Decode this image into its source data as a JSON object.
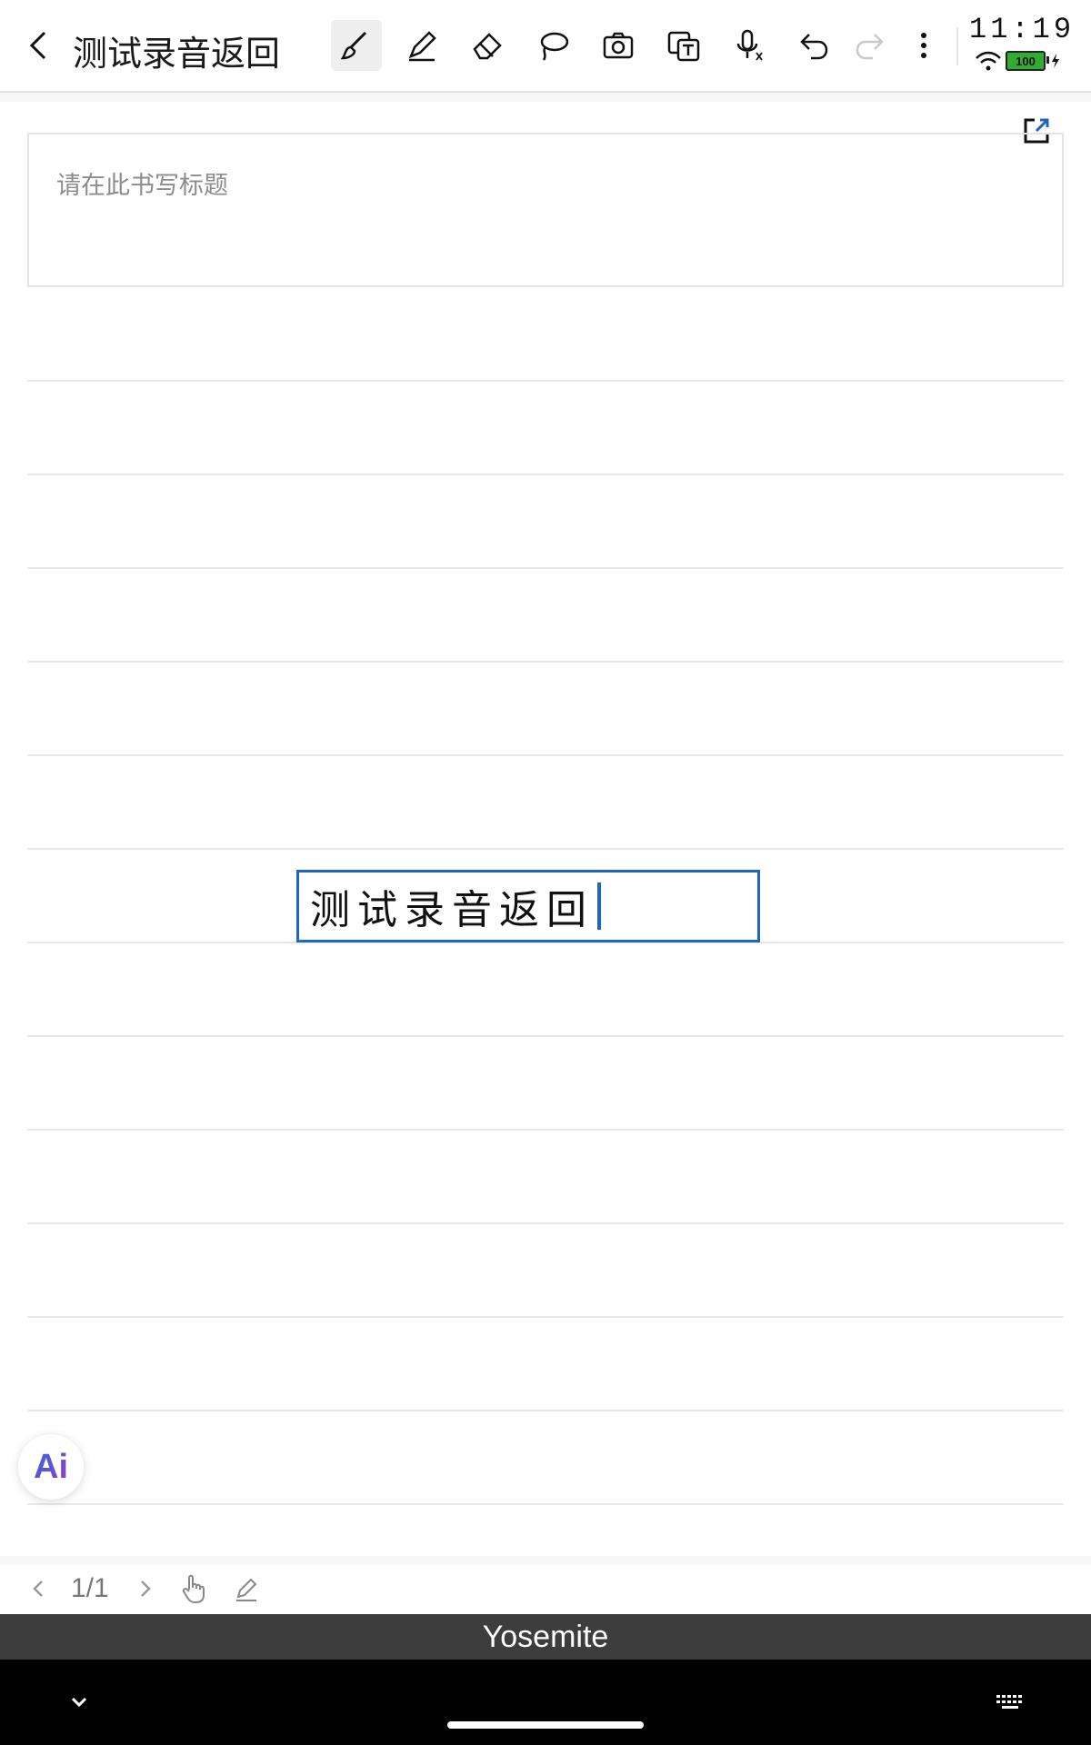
{
  "header": {
    "title": "测试录音返回",
    "toolbar": [
      {
        "name": "brush-tool",
        "icon": "brush-icon",
        "active": true
      },
      {
        "name": "pen-tool",
        "icon": "pen-icon",
        "active": false
      },
      {
        "name": "eraser-tool",
        "icon": "eraser-icon",
        "active": false
      },
      {
        "name": "lasso-tool",
        "icon": "lasso-icon",
        "active": false
      },
      {
        "name": "camera-tool",
        "icon": "camera-icon",
        "active": false
      },
      {
        "name": "ocr-tool",
        "icon": "text-recognize-icon",
        "active": false
      },
      {
        "name": "voice-tool",
        "icon": "microphone-icon",
        "active": false
      },
      {
        "name": "undo-button",
        "icon": "undo-icon",
        "active": false
      },
      {
        "name": "redo-button",
        "icon": "redo-icon",
        "active": false,
        "disabled": true
      },
      {
        "name": "more-button",
        "icon": "more-vertical-icon",
        "active": false
      }
    ]
  },
  "status": {
    "time": "11:19",
    "battery": "100"
  },
  "note": {
    "title_placeholder": "请在此书写标题",
    "text_box_content": "测试录音返回"
  },
  "ai_button": {
    "label": "Ai"
  },
  "footer": {
    "page_indicator": "1/1"
  },
  "keyboard": {
    "banner": "Yosemite"
  },
  "colors": {
    "accent": "#1f66c4",
    "rule": "#e8e8e8",
    "banner": "#3d3d3d"
  }
}
